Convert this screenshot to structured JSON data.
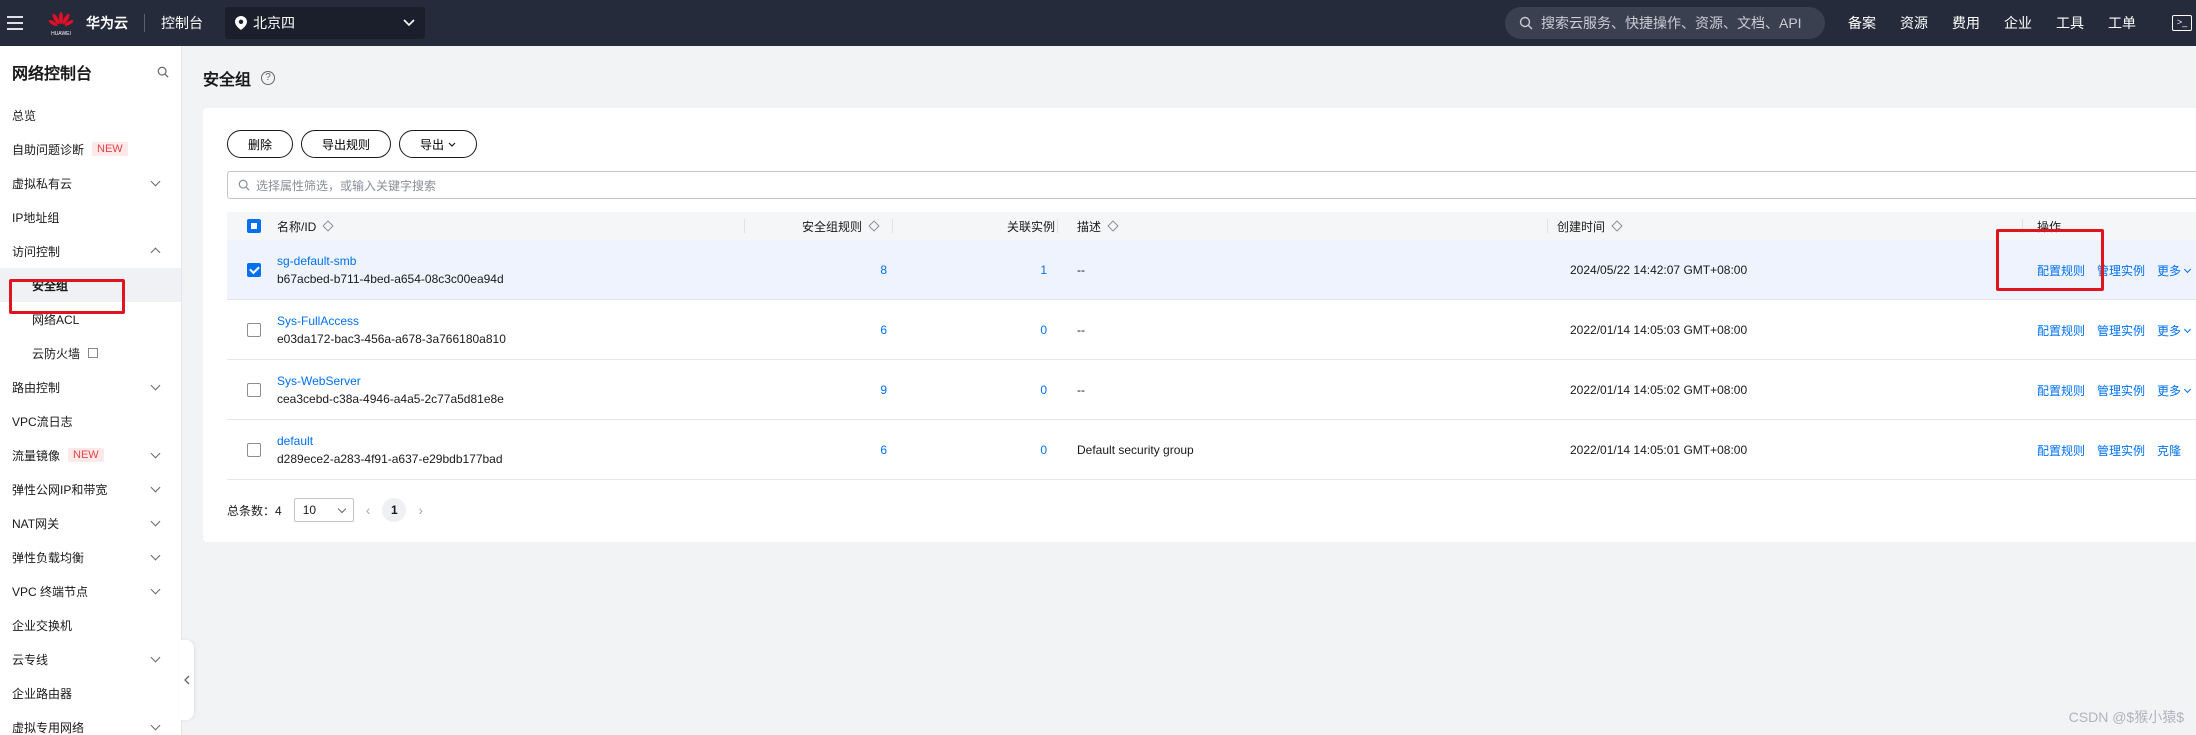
{
  "topbar": {
    "brand_small": "HUAWEI",
    "brand": "华为云",
    "console": "控制台",
    "region": "北京四",
    "search_placeholder": "搜索云服务、快捷操作、资源、文档、API",
    "links": [
      "备案",
      "资源",
      "费用",
      "企业",
      "工具",
      "工单"
    ]
  },
  "sidebar": {
    "title": "网络控制台",
    "items": [
      {
        "label": "总览",
        "badge": "",
        "chevron": "none"
      },
      {
        "label": "自助问题诊断",
        "badge": "NEW",
        "chevron": "none"
      },
      {
        "label": "虚拟私有云",
        "badge": "",
        "chevron": "down"
      },
      {
        "label": "IP地址组",
        "badge": "",
        "chevron": "none"
      },
      {
        "label": "访问控制",
        "badge": "",
        "chevron": "up"
      },
      {
        "label": "安全组",
        "badge": "",
        "chevron": "none",
        "sub": true,
        "active": true
      },
      {
        "label": "网络ACL",
        "badge": "",
        "chevron": "none",
        "sub": true
      },
      {
        "label": "云防火墙",
        "badge": "",
        "chevron": "none",
        "sub": true,
        "external": true
      },
      {
        "label": "路由控制",
        "badge": "",
        "chevron": "down"
      },
      {
        "label": "VPC流日志",
        "badge": "",
        "chevron": "none"
      },
      {
        "label": "流量镜像",
        "badge": "NEW",
        "chevron": "down"
      },
      {
        "label": "弹性公网IP和带宽",
        "badge": "",
        "chevron": "down"
      },
      {
        "label": "NAT网关",
        "badge": "",
        "chevron": "down"
      },
      {
        "label": "弹性负载均衡",
        "badge": "",
        "chevron": "down"
      },
      {
        "label": "VPC 终端节点",
        "badge": "",
        "chevron": "down"
      },
      {
        "label": "企业交换机",
        "badge": "",
        "chevron": "none"
      },
      {
        "label": "云专线",
        "badge": "",
        "chevron": "down"
      },
      {
        "label": "企业路由器",
        "badge": "",
        "chevron": "none"
      },
      {
        "label": "虚拟专用网络",
        "badge": "",
        "chevron": "down"
      }
    ]
  },
  "page": {
    "title": "安全组",
    "help": "?"
  },
  "toolbar": {
    "delete": "删除",
    "export_rules": "导出规则",
    "export": "导出"
  },
  "filter": {
    "placeholder": "选择属性筛选，或输入关键字搜索"
  },
  "table": {
    "headers": {
      "name": "名称/ID",
      "rules": "安全组规则",
      "instances": "关联实例",
      "desc": "描述",
      "created": "创建时间",
      "ops": "操作"
    },
    "rows": [
      {
        "name": "sg-default-smb",
        "id": "b67acbed-b711-4bed-a654-08c3c00ea94d",
        "rules": "8",
        "instances": "1",
        "desc": "--",
        "created": "2024/05/22 14:42:07 GMT+08:00",
        "op1": "配置规则",
        "op2": "管理实例",
        "op3": "更多",
        "selected": true
      },
      {
        "name": "Sys-FullAccess",
        "id": "e03da172-bac3-456a-a678-3a766180a810",
        "rules": "6",
        "instances": "0",
        "desc": "--",
        "created": "2022/01/14 14:05:03 GMT+08:00",
        "op1": "配置规则",
        "op2": "管理实例",
        "op3": "更多",
        "selected": false
      },
      {
        "name": "Sys-WebServer",
        "id": "cea3cebd-c38a-4946-a4a5-2c77a5d81e8e",
        "rules": "9",
        "instances": "0",
        "desc": "--",
        "created": "2022/01/14 14:05:02 GMT+08:00",
        "op1": "配置规则",
        "op2": "管理实例",
        "op3": "更多",
        "selected": false
      },
      {
        "name": "default",
        "id": "d289ece2-a283-4f91-a637-e29bdb177bad",
        "rules": "6",
        "instances": "0",
        "desc": "Default security group",
        "created": "2022/01/14 14:05:01 GMT+08:00",
        "op1": "配置规则",
        "op2": "管理实例",
        "op3": "克隆",
        "selected": false
      }
    ]
  },
  "pager": {
    "total_label": "总条数：",
    "total": "4",
    "page_size": "10",
    "current": "1"
  },
  "watermark": "CSDN @$猴小猿$",
  "colors": {
    "topbar": "#252b3a",
    "link": "#0070f3",
    "highlight_box": "#e0141e",
    "badge": "#e54545"
  }
}
